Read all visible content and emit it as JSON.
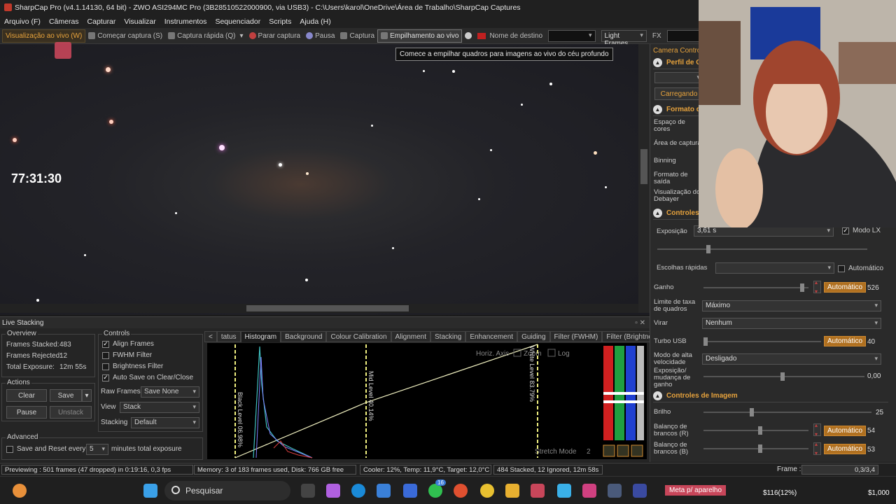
{
  "window": {
    "title": "SharpCap Pro (v4.1.14130, 64 bit) - ZWO ASI294MC Pro (3B28510522000900, via USB3) - C:\\Users\\karol\\OneDrive\\Área de Trabalho\\SharpCap Captures"
  },
  "menu": [
    "Arquivo (F)",
    "Câmeras",
    "Capturar",
    "Visualizar",
    "Instrumentos",
    "Sequenciador",
    "Scripts",
    "Ajuda (H)"
  ],
  "toolbar": {
    "live_view": "Visualização ao vivo (W)",
    "start_capture": "Começar captura (S)",
    "quick_capture": "Captura rápida (Q)",
    "stop_capture": "Parar captura",
    "pause": "Pausa",
    "capture": "Captura",
    "live_stack": "Empilhamento ao vivo",
    "target_name": "Nome de destino",
    "frame_type": "Light Frames",
    "fx": "FX"
  },
  "tooltip": "Comece a empilhar quadros para imagens ao vivo do céu profundo",
  "overlay_timer": "77:31:30",
  "live_stacking": {
    "title": "Live Stacking",
    "overview": {
      "title": "Overview",
      "frames_stacked_label": "Frames Stacked:",
      "frames_stacked": "483",
      "frames_rejected_label": "Frames Rejected:",
      "frames_rejected": "12",
      "total_exposure_label": "Total Exposure:",
      "total_exposure": "12m 55s"
    },
    "actions": {
      "title": "Actions",
      "clear": "Clear",
      "save": "Save",
      "pause": "Pause",
      "unstack": "Unstack"
    },
    "advanced": {
      "title": "Advanced",
      "save_reset_label": "Save and Reset every",
      "save_reset_value": "5",
      "save_reset_suffix": "minutes total exposure"
    },
    "controls": {
      "title": "Controls",
      "align_frames": "Align Frames",
      "fwhm_filter": "FWHM Filter",
      "brightness_filter": "Brightness Filter",
      "auto_save": "Auto Save on Clear/Close",
      "raw_frames_label": "Raw Frames",
      "raw_frames_value": "Save None",
      "view_label": "View",
      "view_value": "Stack",
      "stacking_label": "Stacking",
      "stacking_value": "Default"
    },
    "tabs": [
      "<",
      "tatus",
      "Histogram",
      "Background",
      "Colour Calibration",
      "Alignment",
      "Stacking",
      "Enhancement",
      "Guiding",
      "Filter (FWHM)",
      "Filter (Brightness)",
      ">"
    ],
    "histogram": {
      "horiz_axis": "Horiz. Axis",
      "zoom": "Zoom",
      "log": "Log",
      "black_level": "Black Level 06.98%",
      "mid_level": "Mid Level 40.14%",
      "white_level": "White Level 83.79%",
      "stretch_mode": "Stretch Mode",
      "stretch_value": "2"
    }
  },
  "camera_control": {
    "title": "Camera Contro",
    "profile": "Perfil de C",
    "loading": "Carregando",
    "format": "Formato d",
    "format_labels": [
      "Espaço de cores",
      "Área de captura",
      "Binning",
      "Formato de saída",
      "Visualização do Debayer"
    ],
    "controls": "Controles",
    "exposure_label": "Exposição",
    "exposure_value": "3,61 s",
    "lx_mode": "Modo LX",
    "quick_choices": "Escolhas rápidas",
    "automatic": "Automático",
    "gain_label": "Ganho",
    "gain_auto": "Automático",
    "gain_value": "526",
    "frame_rate_label": "Limite de taxa de quadros",
    "frame_rate_value": "Máximo",
    "flip_label": "Virar",
    "flip_value": "Nenhum",
    "usb_label": "Turbo USB",
    "usb_auto": "Automático",
    "usb_value": "40",
    "hs_label": "Modo de alta velocidade",
    "hs_value": "Desligado",
    "exp_change_label": "Exposição/ mudança de ganho",
    "exp_change_value": "0,00",
    "image_controls": "Controles de Imagem",
    "brightness_label": "Brilho",
    "brightness_value": "25",
    "wb_r_label": "Balanço de brancos (R)",
    "wb_r_auto": "Automático",
    "wb_r_value": "54",
    "wb_b_label": "Balanço de brancos (B)",
    "wb_b_auto": "Automático",
    "wb_b_value": "53"
  },
  "status": {
    "preview": "Previewing : 501 frames (47 dropped) in 0:19:16, 0,3 fps",
    "memory": "Memory: 3 of 183 frames used, Disk: 766 GB free",
    "cooler": "Cooler: 12%, Temp: 11,9°C, Target: 12,0°C",
    "stacked": "484 Stacked, 12 Ignored, 12m 58s",
    "frame_label": "Frame :",
    "frame_value": "0,3/3,4"
  },
  "taskbar": {
    "search": "Pesquisar",
    "badge": "16",
    "meta": "Meta p/ aparelho",
    "amount1": "$116(12%)",
    "amount2": "$1,000"
  },
  "colors": {
    "accent": "#e8a33c",
    "automatic": "#b07020"
  }
}
